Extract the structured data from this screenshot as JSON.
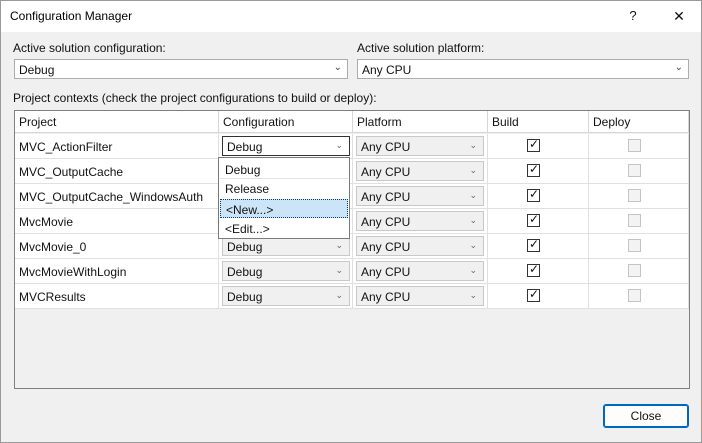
{
  "window": {
    "title": "Configuration Manager",
    "help_glyph": "?",
    "close_glyph": "✕"
  },
  "active_configuration": {
    "label": "Active solution configuration:",
    "value": "Debug"
  },
  "active_platform": {
    "label": "Active solution platform:",
    "value": "Any CPU"
  },
  "contexts_label": "Project contexts (check the project configurations to build or deploy):",
  "grid": {
    "columns": [
      "Project",
      "Configuration",
      "Platform",
      "Build",
      "Deploy"
    ],
    "rows": [
      {
        "project": "MVC_ActionFilter",
        "configuration": "Debug",
        "platform": "Any CPU",
        "build": true,
        "deploy": false
      },
      {
        "project": "MVC_OutputCache",
        "configuration": "Debug",
        "platform": "Any CPU",
        "build": true,
        "deploy": false
      },
      {
        "project": "MVC_OutputCache_WindowsAuth",
        "configuration": "Debug",
        "platform": "Any CPU",
        "build": true,
        "deploy": false
      },
      {
        "project": "MvcMovie",
        "configuration": "Debug",
        "platform": "Any CPU",
        "build": true,
        "deploy": false
      },
      {
        "project": "MvcMovie_0",
        "configuration": "Debug",
        "platform": "Any CPU",
        "build": true,
        "deploy": false
      },
      {
        "project": "MvcMovieWithLogin",
        "configuration": "Debug",
        "platform": "Any CPU",
        "build": true,
        "deploy": false
      },
      {
        "project": "MVCResults",
        "configuration": "Debug",
        "platform": "Any CPU",
        "build": true,
        "deploy": false
      }
    ]
  },
  "dropdown": {
    "items": [
      "Debug",
      "Release",
      "<New...>",
      "<Edit...>"
    ],
    "selected": "<New...>"
  },
  "close_button": "Close",
  "icons": {
    "chevron": "chevron-down-icon",
    "check": "checkmark-icon"
  }
}
